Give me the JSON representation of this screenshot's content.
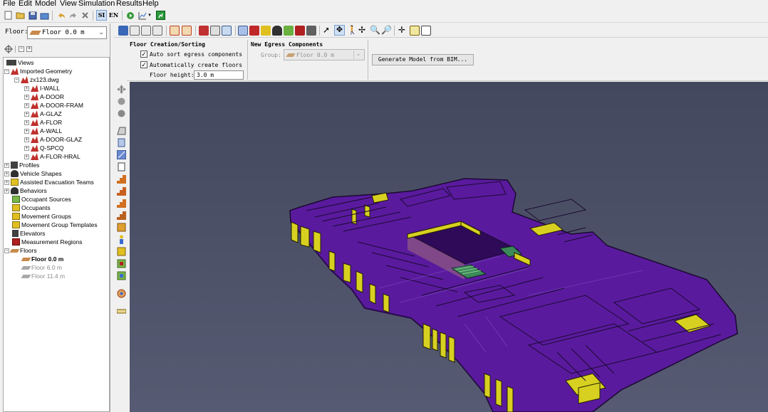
{
  "menu": [
    "File",
    "Edit",
    "Model",
    "View",
    "Simulation",
    "Results",
    "Help"
  ],
  "units": {
    "si": "SI",
    "en": "EN"
  },
  "floor_selector": {
    "label": "Floor:",
    "value": "Floor 0.0 m"
  },
  "tree": {
    "views": "Views",
    "imported_geometry": "Imported Geometry",
    "file": "zx123.dwg",
    "layers": [
      "I-WALL",
      "A-DOOR",
      "A-DOOR-FRAM",
      "A-GLAZ",
      "A-FLOR",
      "A-WALL",
      "A-DOOR-GLAZ",
      "Q-SPCQ",
      "A-FLOR-HRAL"
    ],
    "sections": [
      "Profiles",
      "Vehicle Shapes",
      "Assisted Evacuation Teams",
      "Behaviors",
      "Occupant Sources",
      "Occupants",
      "Movement Groups",
      "Movement Group Templates",
      "Elevators",
      "Measurement Regions",
      "Floors"
    ],
    "floors": [
      "Floor 0.0 m",
      "Floor 6.0 m",
      "Floor 11.4 m"
    ]
  },
  "panel": {
    "floor_creation_title": "Floor Creation/Sorting",
    "auto_sort_label": "Auto sort egress components",
    "auto_sort_checked": true,
    "auto_create_label": "Automatically create floors",
    "auto_create_checked": true,
    "floor_height_label": "Floor height:",
    "floor_height_value": "3.0 m",
    "new_egress_title": "New Egress Components",
    "group_label": "Group:",
    "group_value": "Floor 0.0 m",
    "generate_button": "Generate Model from BIM..."
  },
  "colors": {
    "floor_plate": "#5a1a9e",
    "walls": "#d8d020",
    "viewport_bg": "#4a4e66",
    "stairs": "#3c8a5a"
  }
}
